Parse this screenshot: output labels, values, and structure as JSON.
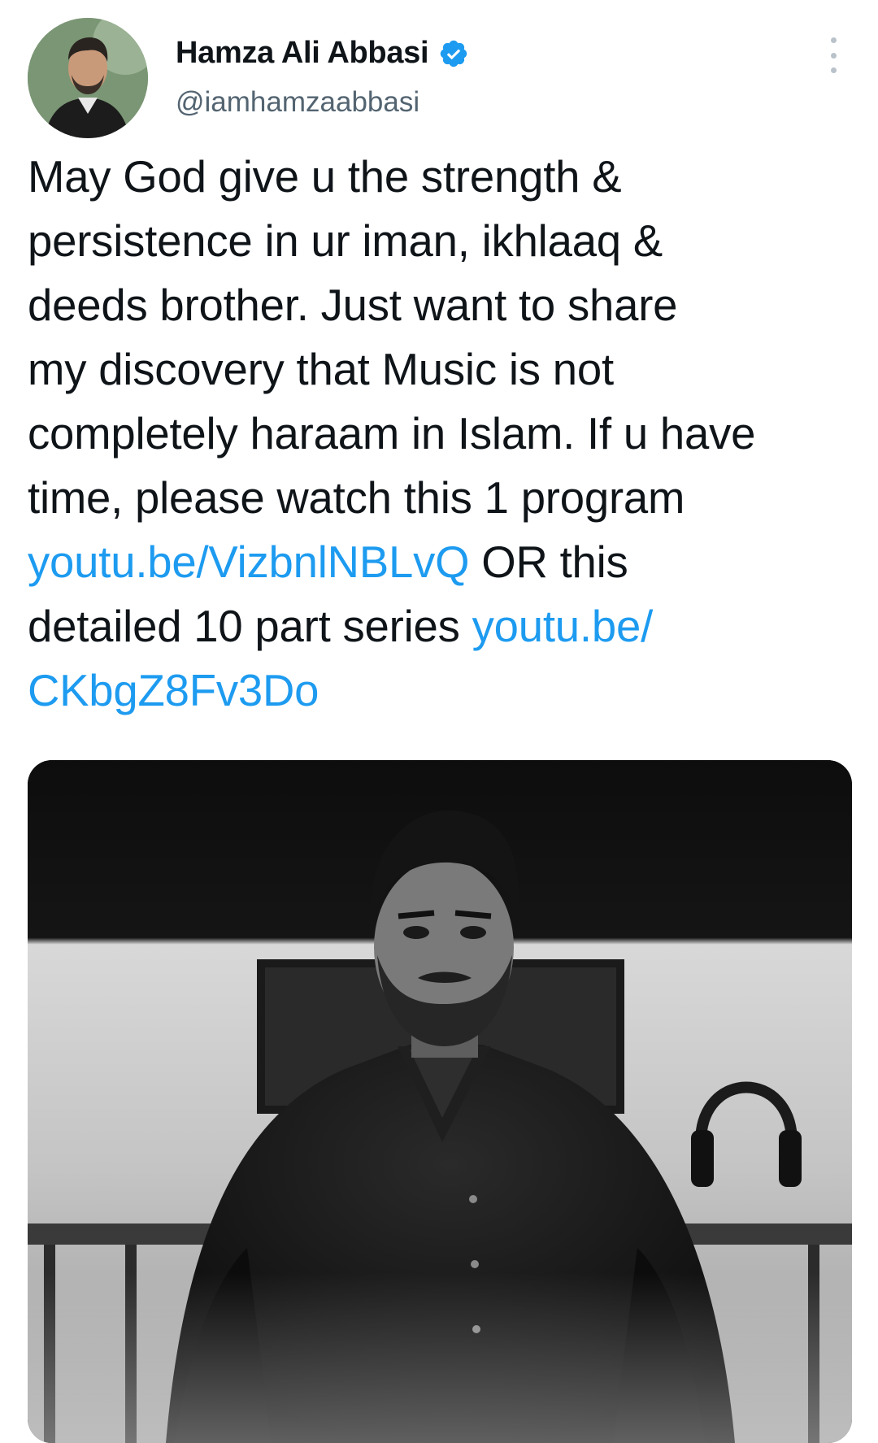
{
  "author": {
    "display_name": "Hamza Ali Abbasi",
    "handle": "@iamhamzaabbasi",
    "verified": true
  },
  "menu": {
    "icon": "more-vertical-icon"
  },
  "tweet": {
    "lines": [
      {
        "text": "May God give u the strength &"
      },
      {
        "text": "persistence in ur iman, ikhlaaq &"
      },
      {
        "text": "deeds brother. Just want to share"
      },
      {
        "text": "my discovery that Music is not"
      },
      {
        "text": "completely haraam in Islam. If u have"
      },
      {
        "text": "time, please watch this 1 program"
      },
      {
        "link1": "youtu.be/VizbnlNBLvQ",
        "after": " OR this"
      },
      {
        "before": "detailed 10 part series ",
        "link2_part1": "youtu.be/"
      },
      {
        "link2_part2": "CKbgZ8Fv3Do"
      }
    ]
  },
  "colors": {
    "link": "#1d9bf0",
    "text": "#0f1419",
    "secondary": "#536471",
    "verified": "#1d9bf0"
  },
  "media": {
    "type": "photo",
    "style": "black-and-white portrait"
  }
}
